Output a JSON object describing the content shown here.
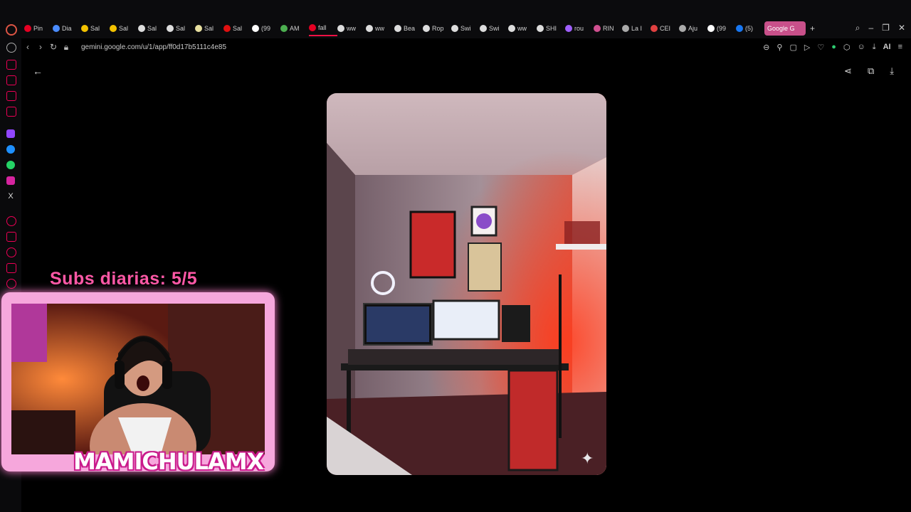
{
  "browser": {
    "tabs": [
      {
        "label": "Pin",
        "color": "#e60023"
      },
      {
        "label": "Dia",
        "color": "#4a8cff"
      },
      {
        "label": "Sal",
        "color": "#f3c200"
      },
      {
        "label": "Sal",
        "color": "#f3c200"
      },
      {
        "label": "Sal",
        "color": "#dddddd"
      },
      {
        "label": "Sal",
        "color": "#dddddd"
      },
      {
        "label": "Sal",
        "color": "#e8e0a0"
      },
      {
        "label": "Sal",
        "color": "#e01010"
      },
      {
        "label": "(99",
        "color": "#ffffff"
      },
      {
        "label": "AM",
        "color": "#4caf50"
      },
      {
        "label": "fall",
        "color": "#e60023"
      },
      {
        "label": "ww",
        "color": "#dddddd"
      },
      {
        "label": "ww",
        "color": "#dddddd"
      },
      {
        "label": "Bea",
        "color": "#dddddd"
      },
      {
        "label": "Rop",
        "color": "#dddddd"
      },
      {
        "label": "Swi",
        "color": "#dddddd"
      },
      {
        "label": "Swi",
        "color": "#dddddd"
      },
      {
        "label": "ww",
        "color": "#dddddd"
      },
      {
        "label": "SHI",
        "color": "#dddddd"
      },
      {
        "label": "rou",
        "color": "#a060ff"
      },
      {
        "label": "RIN",
        "color": "#d05090"
      },
      {
        "label": "La I",
        "color": "#aaaaaa"
      },
      {
        "label": "CEI",
        "color": "#e04040"
      },
      {
        "label": "Aju",
        "color": "#aaaaaa"
      },
      {
        "label": "(99",
        "color": "#ffffff"
      },
      {
        "label": "(5)",
        "color": "#1877f2"
      }
    ],
    "active_tab": "Google G",
    "url": "gemini.google.com/u/1/app/ff0d17b5111c4e85",
    "ai_label": "AI"
  },
  "overlay": {
    "subs_text": "Subs diarias: 5/5",
    "streamer_name": "MAMICHULAMX"
  }
}
